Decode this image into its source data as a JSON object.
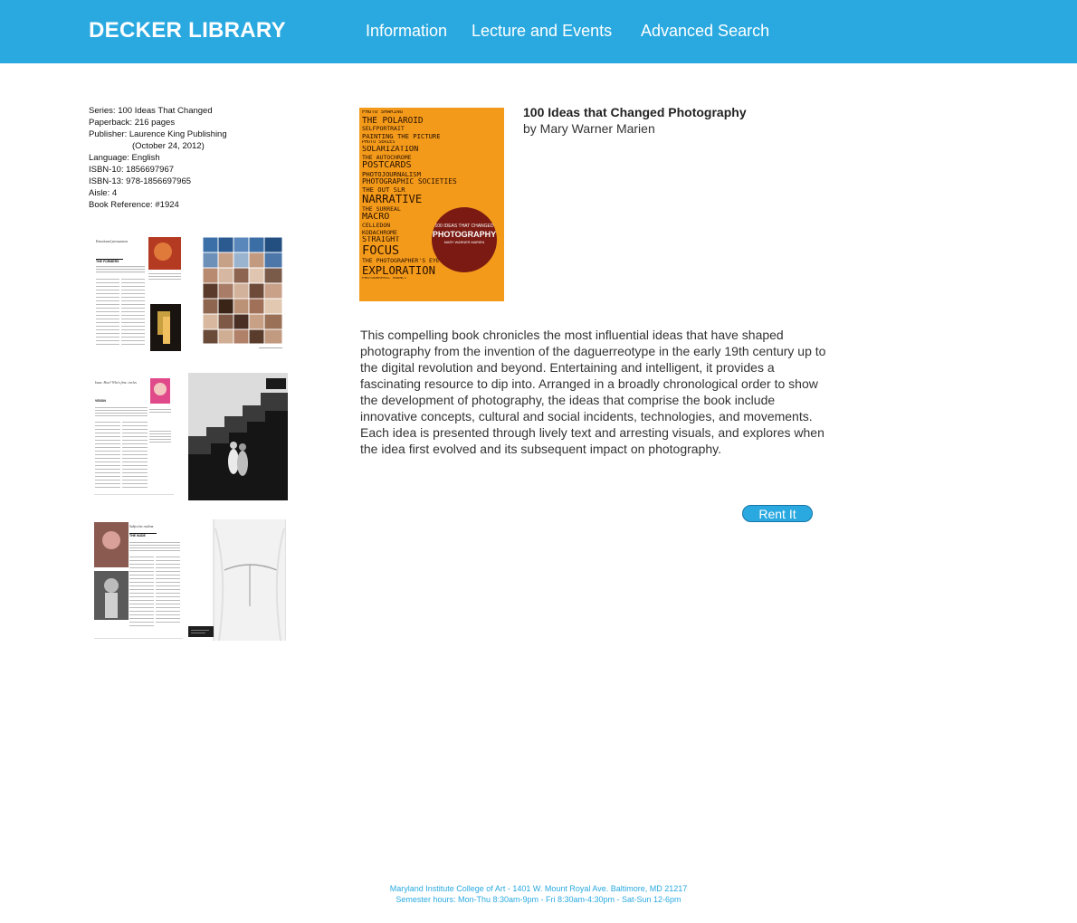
{
  "header": {
    "logo": "DECKER LIBRARY",
    "nav": [
      "Information",
      "Lecture and Events",
      "Advanced Search"
    ]
  },
  "details": {
    "series": "Series: 100 Ideas That Changed",
    "paperback": "Paperback: 216 pages",
    "publisher": "Publisher: Laurence King Publishing",
    "publish_date": "(October 24, 2012)",
    "language": "Language: English",
    "isbn10": "ISBN-10: 1856697967",
    "isbn13": "ISBN-13: 978-1856697965",
    "aisle": "Aisle: 4",
    "reference": "Book Reference: #1924"
  },
  "thumbnails": {
    "t1": "Emotional persuasion",
    "t1_head": "THE FORMERS",
    "t3": "Issue: How? Who's first: circles",
    "t3_head": "VISION",
    "t5": "Subjective realism",
    "t5_head": "THE NUDE"
  },
  "book": {
    "title": "100 Ideas that Changed Photography",
    "author": "by Mary Warner Marien",
    "description": "This compelling book chronicles the most influential ideas that have shaped photography from the invention of the daguerreotype in the early 19th century up to the digital revolution and beyond. Entertaining and intelligent, it provides a fascinating resource to dip into. Arranged in a broadly chronological order to show the development of photography, the ideas that comprise the book include innovative concepts, cultural and social incidents, technologies, and movements. Each idea is presented through lively text and arresting visuals, and explores when the idea first evolved and its subsequent impact on photography."
  },
  "cover": {
    "lines": [
      "PHOTO SHARING",
      "THE POLAROID",
      "SELFPORTRAIT",
      "PAINTING THE PICTURE",
      "PHOTO SERIES",
      "SOLARIZATION",
      "THE AUTOCHROME",
      "POSTCARDS",
      "PHOTOJOURNALISM",
      "PHOTOGRAPHIC SOCIETIES",
      "THE OUT SLR",
      "NARRATIVE",
      "THE SURREAL",
      "MACRO",
      "CELLEDON",
      "KODACHROME",
      "STRAIGHT",
      "FOCUS",
      "THE PHOTOGRAPHER'S EYE",
      "EXPLORATION",
      "PHOTOGRAPHIC AGENCY"
    ],
    "badge_top": "100 IDEAS THAT CHANGED",
    "badge_main": "PHOTOGRAPHY",
    "badge_author": "MARY WARNER MARIEN",
    "colors": {
      "background": "#f39a1b",
      "badge": "#7a1a12"
    }
  },
  "actions": {
    "rent": "Rent It"
  },
  "footer": {
    "line1": "Maryland Institute College of Art - 1401 W. Mount Royal Ave. Baltimore, MD 21217",
    "line2": "Semester hours: Mon-Thu 8:30am-9pm - Fri 8:30am-4:30pm - Sat-Sun 12-6pm"
  },
  "colors": {
    "header": "#2aa9e0",
    "link": "#2aa9e0",
    "body_text": "#333333"
  }
}
